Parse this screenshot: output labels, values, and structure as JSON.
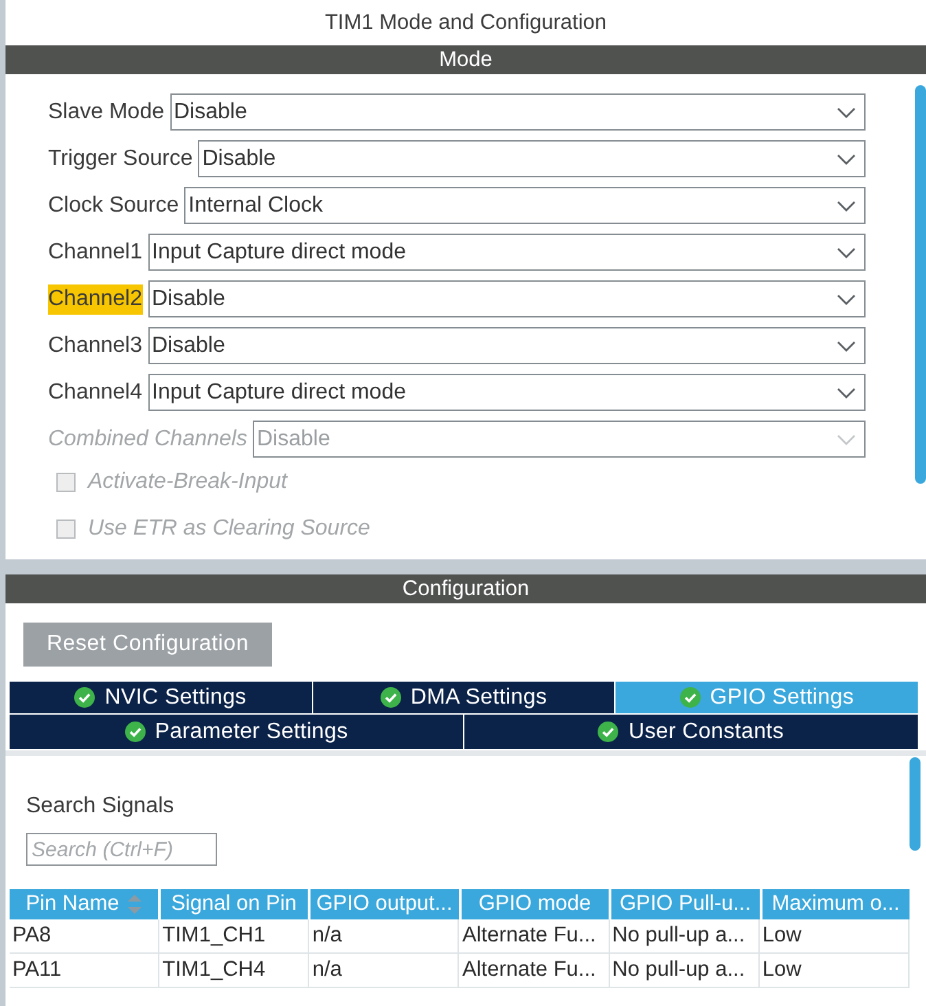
{
  "title": "TIM1 Mode and Configuration",
  "mode": {
    "header": "Mode",
    "fields": [
      {
        "label": "Slave Mode",
        "value": "Disable",
        "highlighted": false,
        "disabled": false
      },
      {
        "label": "Trigger Source",
        "value": "Disable",
        "highlighted": false,
        "disabled": false
      },
      {
        "label": "Clock Source",
        "value": "Internal Clock",
        "highlighted": false,
        "disabled": false
      },
      {
        "label": "Channel1",
        "value": "Input Capture direct mode",
        "highlighted": false,
        "disabled": false
      },
      {
        "label": "Channel2",
        "value": "Disable",
        "highlighted": true,
        "disabled": false
      },
      {
        "label": "Channel3",
        "value": "Disable",
        "highlighted": false,
        "disabled": false
      },
      {
        "label": "Channel4",
        "value": "Input Capture direct mode",
        "highlighted": false,
        "disabled": false
      },
      {
        "label": "Combined Channels",
        "value": "Disable",
        "highlighted": false,
        "disabled": true
      }
    ],
    "checkboxes": [
      {
        "label": "Activate-Break-Input",
        "checked": false,
        "disabled": true
      },
      {
        "label": "Use ETR as Clearing Source",
        "checked": false,
        "disabled": true
      }
    ]
  },
  "configuration": {
    "header": "Configuration",
    "reset_button": "Reset Configuration",
    "tab_rows": [
      [
        {
          "label": "NVIC Settings",
          "selected": false
        },
        {
          "label": "DMA Settings",
          "selected": false
        },
        {
          "label": "GPIO Settings",
          "selected": true
        }
      ],
      [
        {
          "label": "Parameter Settings",
          "selected": false
        },
        {
          "label": "User Constants",
          "selected": false
        }
      ]
    ],
    "search": {
      "label": "Search Signals",
      "placeholder": "Search (Ctrl+F)"
    },
    "table": {
      "columns": [
        {
          "label": "Pin Name",
          "sortable": true
        },
        {
          "label": "Signal on Pin",
          "sortable": false
        },
        {
          "label": "GPIO output...",
          "sortable": false
        },
        {
          "label": "GPIO mode",
          "sortable": false
        },
        {
          "label": "GPIO Pull-u...",
          "sortable": false
        },
        {
          "label": "Maximum o...",
          "sortable": false
        }
      ],
      "rows": [
        {
          "cells": [
            "PA8",
            "TIM1_CH1",
            "n/a",
            "Alternate Fu...",
            "No pull-up a...",
            "Low"
          ]
        },
        {
          "cells": [
            "PA11",
            "TIM1_CH4",
            "n/a",
            "Alternate Fu...",
            "No pull-up a...",
            "Low"
          ]
        }
      ]
    }
  }
}
